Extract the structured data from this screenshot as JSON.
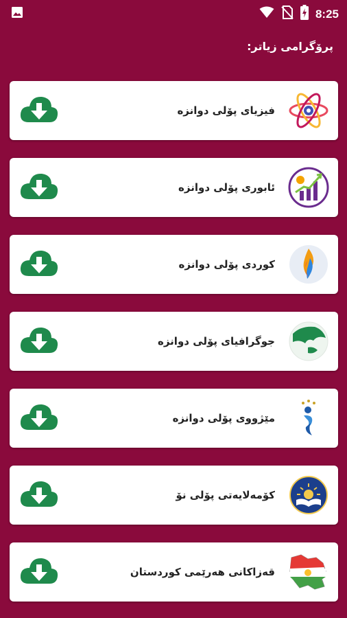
{
  "status_bar": {
    "time": "8:25",
    "icons": [
      "image-icon",
      "wifi-icon",
      "no-sim-icon",
      "battery-charging-icon"
    ]
  },
  "header": {
    "title": "پرۆگرامی زیاتر:"
  },
  "colors": {
    "background": "#8a0a3c",
    "card": "#ffffff",
    "download": "#1f8a4c"
  },
  "apps": [
    {
      "title": "فیزیای پۆلی دوانزه",
      "icon": "physics-atom-icon"
    },
    {
      "title": "ئابوری پۆلی دوانزه",
      "icon": "economics-chart-icon"
    },
    {
      "title": "کوردی پۆلی دوانزه",
      "icon": "kurdish-flame-icon"
    },
    {
      "title": "جوگرافیای پۆلی دوانزه",
      "icon": "geography-globe-icon"
    },
    {
      "title": "مێژووی پۆلی دوانزه",
      "icon": "history-figure-icon"
    },
    {
      "title": "کۆمەلایەتی پۆلی نۆ",
      "icon": "social-book-icon"
    },
    {
      "title": "قەزاکانی هەرێمی کوردستان",
      "icon": "kurdistan-map-icon"
    }
  ]
}
